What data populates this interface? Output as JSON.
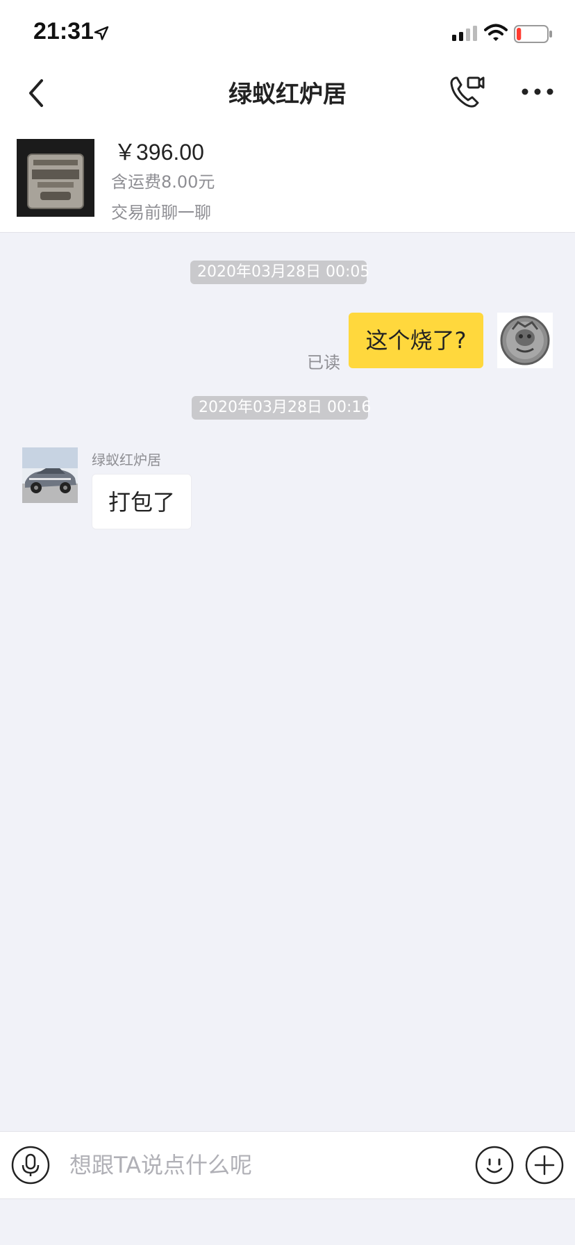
{
  "status_bar": {
    "time": "21:31",
    "location_icon": "location-arrow-icon",
    "signal_icon": "cellular-signal-icon",
    "wifi_icon": "wifi-icon",
    "battery_icon": "battery-low-icon",
    "battery_level": 0.15,
    "battery_color": "#ff3b30"
  },
  "nav": {
    "title": "绿蚁红炉居",
    "back_icon": "chevron-left-icon",
    "call_icon": "phone-video-icon",
    "more_icon": "more-dots-icon"
  },
  "product": {
    "price": "￥396.00",
    "shipping": "含运费8.00元",
    "chat_hint": "交易前聊一聊",
    "thumbnail_icon": "zippo-lighter-image"
  },
  "chat": {
    "messages": [
      {
        "timestamp": "2020年03月28日 00:05",
        "from": "me",
        "text": "这个烧了?",
        "read_status": "已读"
      },
      {
        "timestamp": "2020年03月28日 00:16",
        "from": "other",
        "sender_name": "绿蚁红炉居",
        "text": "打包了"
      }
    ]
  },
  "input_bar": {
    "placeholder": "想跟TA说点什么呢",
    "value": "",
    "mic_icon": "microphone-icon",
    "emoji_icon": "smiley-icon",
    "plus_icon": "plus-circle-icon"
  },
  "colors": {
    "accent": "#ffd83d",
    "background": "#f1f2f8",
    "timestamp_bg": "#c9c9cc"
  }
}
